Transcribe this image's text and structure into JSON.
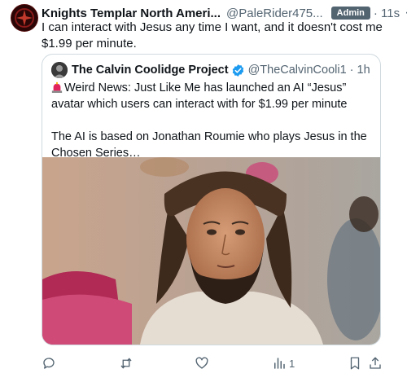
{
  "post": {
    "author_name": "Knights Templar North Ameri...",
    "author_handle": "@PaleRider475...",
    "badge": "Admin",
    "time": "· 11s",
    "more": "···",
    "text": "I can interact with Jesus any time I want, and it doesn't cost me $1.99 per minute."
  },
  "quoted": {
    "author_name": "The Calvin Coolidge Project",
    "author_handle": "@TheCalvinCooli1",
    "time": "· 1h",
    "line1": "Weird News: Just Like Me has launched an AI “Jesus” avatar which users can interact with for $1.99 per minute",
    "line2": "The AI is based on Jonathan Roumie who plays Jesus in the Chosen Series…"
  },
  "actions": {
    "reply_count": "",
    "repost_count": "",
    "like_count": "",
    "views_count": "1"
  },
  "icons": {
    "verified": "verified-badge-icon",
    "grok": "grok-icon",
    "siren": "police-light-icon",
    "reply": "reply-icon",
    "repost": "repost-icon",
    "like": "like-icon",
    "views": "views-icon",
    "bookmark": "bookmark-icon",
    "share": "share-icon"
  },
  "colors": {
    "verified_blue": "#1d9bf0",
    "muted": "#536471",
    "badge_bg": "#536471"
  }
}
